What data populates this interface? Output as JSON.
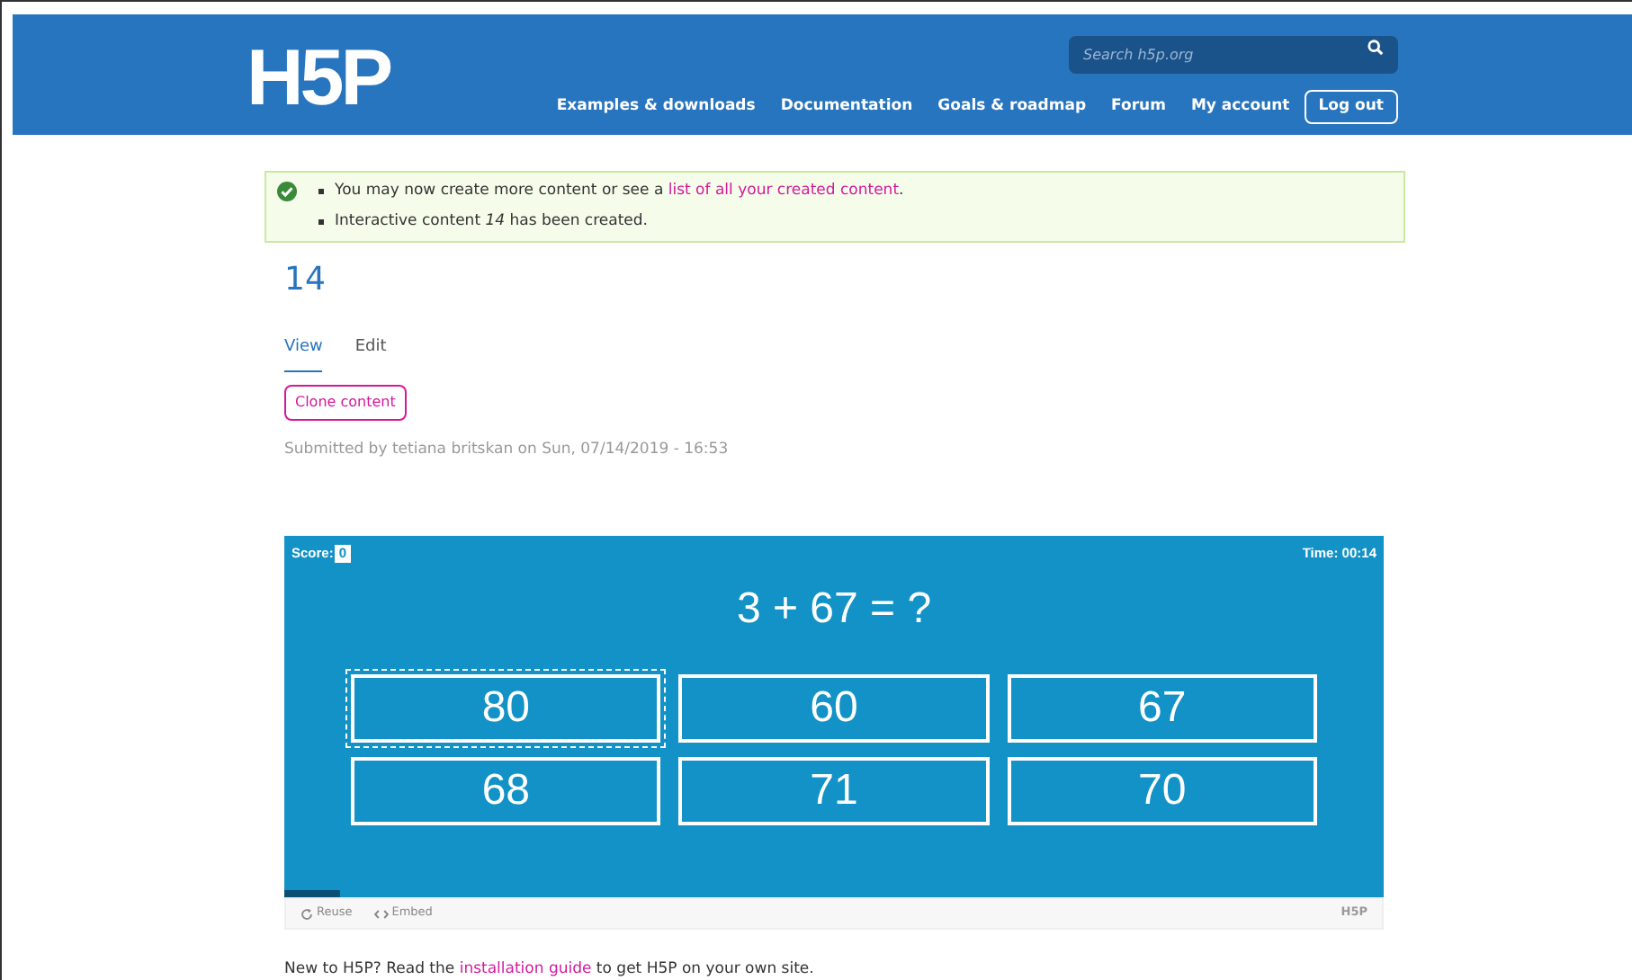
{
  "header": {
    "logo": "H5P",
    "search": {
      "placeholder": "Search h5p.org"
    },
    "nav": [
      "Examples & downloads",
      "Documentation",
      "Goals & roadmap",
      "Forum",
      "My account"
    ],
    "logout": "Log out"
  },
  "messages": [
    {
      "parts": [
        {
          "kind": "text",
          "text": "You may now create more content or see a "
        },
        {
          "kind": "link",
          "text": "list of all your created content"
        },
        {
          "kind": "text",
          "text": "."
        }
      ]
    },
    {
      "parts": [
        {
          "kind": "text",
          "text": "Interactive content *14* has been created."
        }
      ]
    }
  ],
  "title": "14",
  "tabs": [
    {
      "label": "View",
      "selected": true
    },
    {
      "label": "Edit",
      "selected": false
    }
  ],
  "clone_button": "Clone content",
  "submitted": "Submitted by tetiana britskan on Sun, 07/14/2019 - 16:53",
  "game": {
    "score_label": "Score:",
    "score": "0",
    "time": "Time: 00:14",
    "question": "3 + 67 = ?",
    "answers": [
      {
        "label": "80",
        "focused": true
      },
      {
        "label": "60",
        "focused": false
      },
      {
        "label": "67",
        "focused": false
      },
      {
        "label": "68",
        "focused": false
      },
      {
        "label": "71",
        "focused": false
      },
      {
        "label": "70",
        "focused": false
      }
    ],
    "progress": {
      "level": 0.05
    },
    "footer": {
      "reuse": "Reuse",
      "embed": "Embed",
      "logo": "H5P"
    }
  },
  "footer_text": [
    {
      "kind": "text",
      "text": "New to H5P? Read the "
    },
    {
      "kind": "link",
      "text": "installation guide"
    },
    {
      "kind": "text",
      "text": " to get H5P on your own site."
    }
  ]
}
